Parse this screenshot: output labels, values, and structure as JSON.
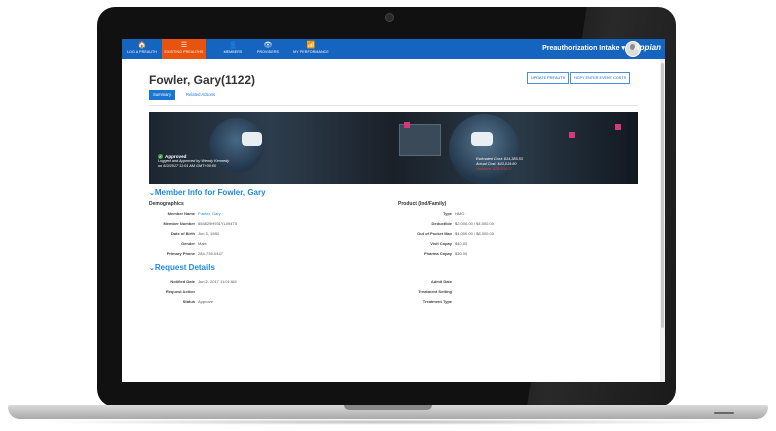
{
  "nav": {
    "items": [
      {
        "label": "LOG A PREAUTH",
        "icon": "home-icon",
        "glyph": "🏠"
      },
      {
        "label": "EXISTING PREAUTHS",
        "icon": "list-icon",
        "glyph": "☰"
      },
      {
        "label": "MEMBERS",
        "icon": "person-icon",
        "glyph": "👤"
      },
      {
        "label": "PROVIDERS",
        "icon": "eye-icon",
        "glyph": "👁"
      },
      {
        "label": "MY PERFORMANCE",
        "icon": "bar-chart-icon",
        "glyph": "📶"
      }
    ],
    "active_index": 1,
    "app_title": "Preauthorization Intake ▾",
    "logo": "Appian"
  },
  "page": {
    "title": "Fowler, Gary(1122)",
    "buttons": {
      "update": "UPDATE PREAUTH",
      "enter_costs": "HCPY ENTER EVENT COSTS"
    },
    "tabs": {
      "summary": "Summary",
      "related": "Related Actions"
    }
  },
  "banner": {
    "status": "Approved",
    "approved_by": "Logged and Approved by Wendy Kennedy",
    "approved_on": "on 6/2/2017 11:01 AM GMT+00:00",
    "estimated_cost": "Estimated Cost: $14,385.53",
    "actual_cost": "Actual Cost: $43,019.80",
    "variance": "Variance: $28,634.27",
    "colors": {
      "approved": "#43a047",
      "variance": "#e53935"
    }
  },
  "member_info": {
    "heading": "Member Info for Fowler, Gary",
    "demographics_label": "Demographics",
    "fields": [
      {
        "key": "Member Name",
        "value": "Fowler, Gary"
      },
      {
        "key": "Member Number",
        "value": "854829H931YL094T0"
      },
      {
        "key": "Date of Birth",
        "value": "Jun 3, 1980"
      },
      {
        "key": "Gender",
        "value": "Male"
      },
      {
        "key": "Primary Phone",
        "value": "284-739-0447"
      }
    ],
    "product_label": "Product (Ind/Family)",
    "product_fields": [
      {
        "key": "Type",
        "value": "HMO"
      },
      {
        "key": "Deductible",
        "value": "$2,000.00 / $4,000.00"
      },
      {
        "key": "Out of Pocket Max",
        "value": "$4,000.00 / $8,000.00"
      },
      {
        "key": "Visit Copay",
        "value": "$40.00"
      },
      {
        "key": "Pharma Copay",
        "value": "$30.00"
      }
    ]
  },
  "request_details": {
    "heading": "Request Details",
    "fields": [
      {
        "key": "Notified Date",
        "value": "Jun 2, 2017 11:01 AM"
      },
      {
        "key": "Request Action",
        "value": ""
      },
      {
        "key": "Status",
        "value": "Approve"
      }
    ],
    "right_fields": [
      {
        "key": "Admit Date",
        "value": ""
      },
      {
        "key": "Treatment Setting",
        "value": ""
      },
      {
        "key": "Treatment Type",
        "value": ""
      }
    ]
  }
}
